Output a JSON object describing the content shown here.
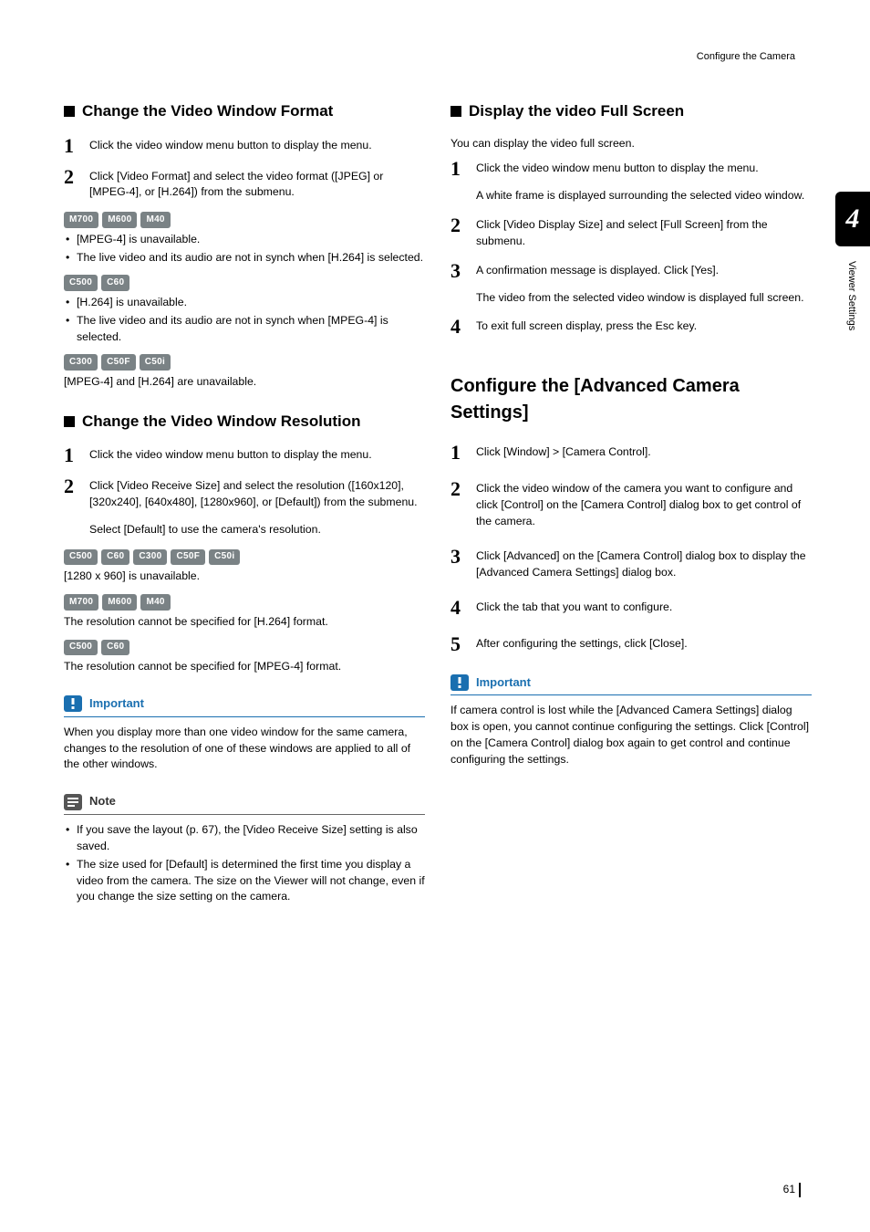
{
  "header": {
    "breadcrumb": "Configure the Camera"
  },
  "thumbtab": {
    "number": "4",
    "label": "Viewer Settings"
  },
  "left": {
    "sec1": {
      "title": "Change the Video Window Format",
      "step1": "Click the video window menu button to display the menu.",
      "step2": "Click [Video Format] and select the video format ([JPEG] or [MPEG-4], or [H.264]) from the submenu.",
      "badges1": [
        "M700",
        "M600",
        "M40"
      ],
      "b1a": "[MPEG-4] is unavailable.",
      "b1b": "The live video and its audio are not in synch when [H.264] is selected.",
      "badges2": [
        "C500",
        "C60"
      ],
      "b2a": "[H.264] is unavailable.",
      "b2b": "The live video and its audio are not in synch when [MPEG-4] is selected.",
      "badges3": [
        "C300",
        "C50F",
        "C50i"
      ],
      "b3": "[MPEG-4] and [H.264] are unavailable."
    },
    "sec2": {
      "title": "Change the Video Window Resolution",
      "step1": "Click the video window menu button to display the menu.",
      "step2": "Click [Video Receive Size] and select the resolution ([160x120], [320x240], [640x480], [1280x960], or [Default]) from the submenu.",
      "step2sub": "Select [Default] to use the camera's resolution.",
      "badges1": [
        "C500",
        "C60",
        "C300",
        "C50F",
        "C50i"
      ],
      "p1": "[1280 x 960] is unavailable.",
      "badges2": [
        "M700",
        "M600",
        "M40"
      ],
      "p2": "The resolution cannot be specified for [H.264] format.",
      "badges3": [
        "C500",
        "C60"
      ],
      "p3": "The resolution cannot be specified for [MPEG-4] format."
    },
    "important": {
      "label": "Important",
      "body": "When you display more than one video window for the same camera, changes to the resolution of one of these windows are applied to all of the other windows."
    },
    "note": {
      "label": "Note",
      "li1": "If you save the layout (p. 67), the [Video Receive Size] setting is also saved.",
      "li2": "The size used for [Default] is determined the first time you display a video from the camera. The size on the Viewer will not change, even if you change the size setting on the camera."
    }
  },
  "right": {
    "sec1": {
      "title": "Display the video Full Screen",
      "intro": "You can display the video full screen.",
      "step1": "Click the video window menu button to display the menu.",
      "step1sub": "A white frame is displayed surrounding the selected video window.",
      "step2": "Click [Video Display Size] and select [Full Screen] from the submenu.",
      "step3": "A confirmation message is displayed. Click [Yes].",
      "step3sub": "The video from the selected video window is displayed full screen.",
      "step4": "To exit full screen display, press the Esc key."
    },
    "sec2": {
      "title": "Configure the [Advanced Camera Settings]",
      "step1": "Click [Window] > [Camera Control].",
      "step2": "Click the video window of the camera you want to configure and click [Control] on the [Camera Control] dialog box to get control of the camera.",
      "step3": "Click [Advanced] on the [Camera Control] dialog box to display the [Advanced Camera Settings] dialog box.",
      "step4": "Click the tab that you want to configure.",
      "step5": "After configuring the settings, click [Close]."
    },
    "important": {
      "label": "Important",
      "body": "If camera control is lost while the [Advanced Camera Settings] dialog box is open, you cannot continue configuring the settings. Click [Control] on the [Camera Control] dialog box again to get control and continue configuring the settings."
    }
  },
  "pagenum": "61"
}
